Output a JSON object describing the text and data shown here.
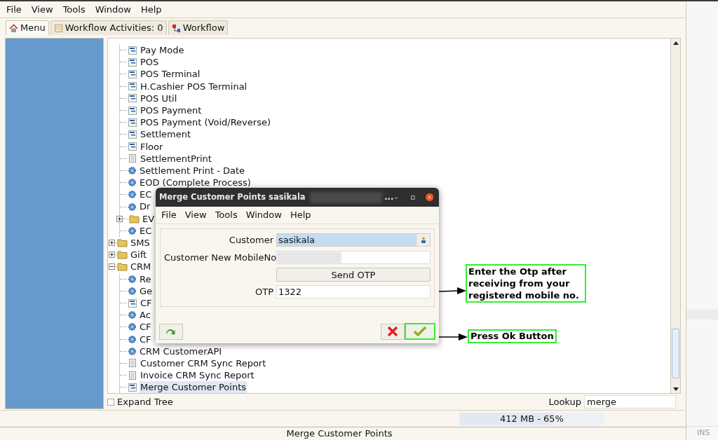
{
  "menu_bar": [
    {
      "label": "File"
    },
    {
      "label": "View"
    },
    {
      "label": "Tools"
    },
    {
      "label": "Window"
    },
    {
      "label": "Help"
    }
  ],
  "tabs": [
    {
      "label": "Menu",
      "kind": "home",
      "selected": true
    },
    {
      "label": "Workflow Activities: 0",
      "kind": "activities",
      "selected": false
    },
    {
      "label": "Workflow",
      "kind": "workflow",
      "selected": false
    }
  ],
  "tree": [
    {
      "children": [
        {
          "label": "Pay Mode",
          "kind": "window",
          "selected": false
        },
        {
          "label": "POS",
          "kind": "window",
          "selected": false
        },
        {
          "label": "POS Terminal",
          "kind": "window",
          "selected": false
        },
        {
          "label": "H.Cashier POS Terminal",
          "kind": "window",
          "selected": false
        },
        {
          "label": "POS Util",
          "kind": "window",
          "selected": false
        },
        {
          "label": "POS Payment",
          "kind": "window",
          "selected": false
        },
        {
          "label": "POS Payment (Void/Reverse)",
          "kind": "window",
          "selected": false
        },
        {
          "label": "Settlement",
          "kind": "window",
          "selected": false
        },
        {
          "label": "Floor",
          "kind": "window",
          "selected": false
        },
        {
          "label": "SettlementPrint",
          "kind": "report",
          "selected": false
        },
        {
          "label": "Settlement Print - Date",
          "kind": "process",
          "selected": false
        },
        {
          "label": "EOD (Complete Process)",
          "kind": "process",
          "selected": false
        },
        {
          "label": "EC",
          "kind": "process",
          "selected": false
        },
        {
          "label": "Dr",
          "kind": "process",
          "selected": false
        },
        {
          "label": "EV",
          "kind": "folder",
          "expanded": false,
          "selected": false
        },
        {
          "label": "EC",
          "kind": "process",
          "selected": false
        }
      ]
    },
    {
      "label": "SMS",
      "kind": "folder",
      "expanded": false,
      "selected": false
    },
    {
      "label": "Gift",
      "kind": "folder",
      "expanded": false,
      "selected": false
    },
    {
      "label": "CRM",
      "kind": "folder",
      "expanded": true,
      "selected": false,
      "children": [
        {
          "label": "Re",
          "kind": "process",
          "selected": false
        },
        {
          "label": "Ge",
          "kind": "process",
          "selected": false
        },
        {
          "label": "CF",
          "kind": "window",
          "selected": false
        },
        {
          "label": "Ac",
          "kind": "process",
          "selected": false
        },
        {
          "label": "CF",
          "kind": "process",
          "selected": false
        },
        {
          "label": "CF",
          "kind": "process",
          "selected": false
        },
        {
          "label": "CRM CustomerAPI",
          "kind": "process",
          "selected": false
        },
        {
          "label": "Customer CRM Sync Report",
          "kind": "report",
          "selected": false
        },
        {
          "label": "Invoice CRM Sync Report",
          "kind": "report",
          "selected": false
        },
        {
          "label": "Merge Customer Points",
          "kind": "window",
          "selected": true
        }
      ]
    }
  ],
  "expand_tree": {
    "label": "Expand Tree",
    "checked": false
  },
  "lookup": {
    "label": "Lookup",
    "value": "merge"
  },
  "memory": {
    "text": "412 MB - 65%",
    "level": 0.65
  },
  "status_bar": {
    "text": "Merge Customer Points",
    "mode": "INS"
  },
  "dialog": {
    "title": "Merge Customer Points  sasikala",
    "title_more": "...",
    "menu_bar": [
      {
        "label": "File"
      },
      {
        "label": "View"
      },
      {
        "label": "Tools"
      },
      {
        "label": "Window"
      },
      {
        "label": "Help"
      }
    ],
    "customer": {
      "label": "Customer",
      "value": "sasikala"
    },
    "mobile": {
      "label": "Customer New MobileNo"
    },
    "send_otp": "Send OTP",
    "otp": {
      "label": "OTP",
      "value": "1322"
    }
  },
  "callouts": [
    {
      "text": "Enter the Otp after receiving from your registered mobile no."
    },
    {
      "text": "Press Ok Button"
    }
  ]
}
